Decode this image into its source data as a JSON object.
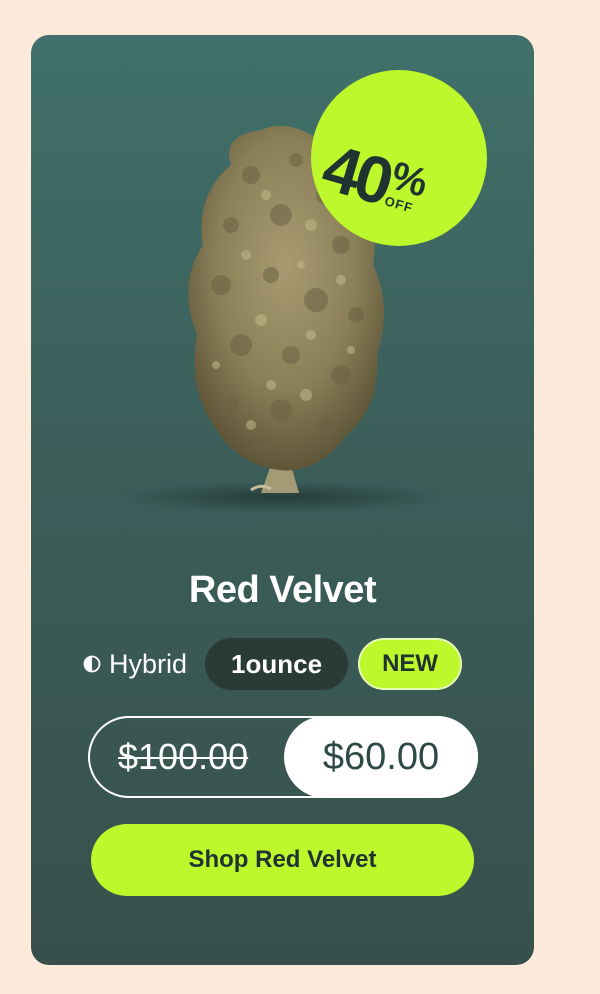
{
  "colors": {
    "page_background": "#FCEADB",
    "card_top": "#41706A",
    "card_bottom": "#38504C",
    "accent_lime": "#BDF82C",
    "dark_pill": "#2A3A36",
    "text_dark": "#1F3431"
  },
  "product": {
    "image_icon": "cannabis-flower-image",
    "name": "Red Velvet",
    "strain_icon": "half-circle-icon",
    "strain": "Hybrid",
    "size": "1ounce",
    "badge_new": "NEW"
  },
  "discount": {
    "percent": "40",
    "symbol": "%",
    "off": "OFF"
  },
  "pricing": {
    "original": "$100.00",
    "sale": "$60.00"
  },
  "cta": {
    "label": "Shop Red Velvet"
  }
}
